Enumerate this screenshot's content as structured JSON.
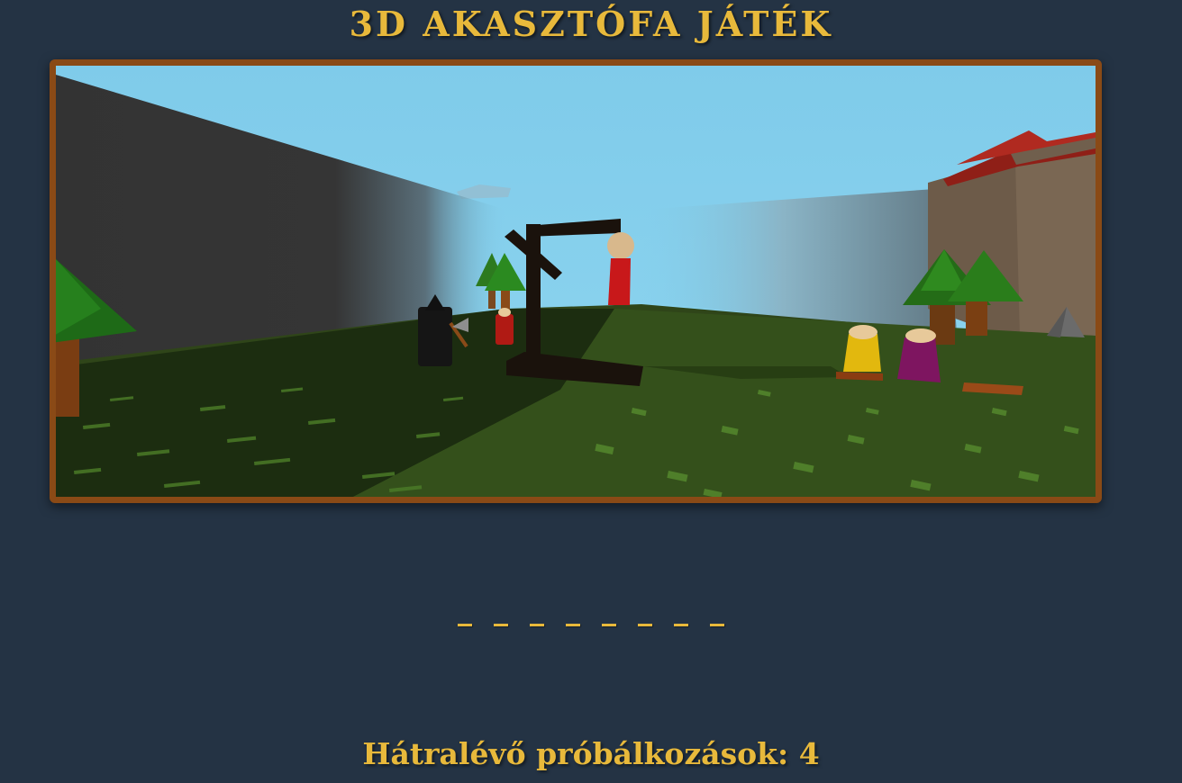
{
  "header": {
    "title": "3D AKASZTÓFA JÁTÉK"
  },
  "scene": {
    "objects": [
      "gallows",
      "hanged-figure",
      "executioner",
      "axe",
      "trees",
      "villagers",
      "logs",
      "castle-wall",
      "rock"
    ],
    "colors": {
      "sky": "#82cdea",
      "grass": "#2f4519",
      "wall": "#333333",
      "gallows": "#1a120c",
      "frame": "#8a4a16"
    }
  },
  "word": {
    "slots": [
      "",
      "",
      "",
      "",
      "",
      "",
      "",
      ""
    ]
  },
  "status": {
    "attempts_text": "Hátralévő próbálkozások: 4",
    "remaining": 4
  },
  "theme": {
    "background": "#243344",
    "accent": "#e8b93b"
  }
}
